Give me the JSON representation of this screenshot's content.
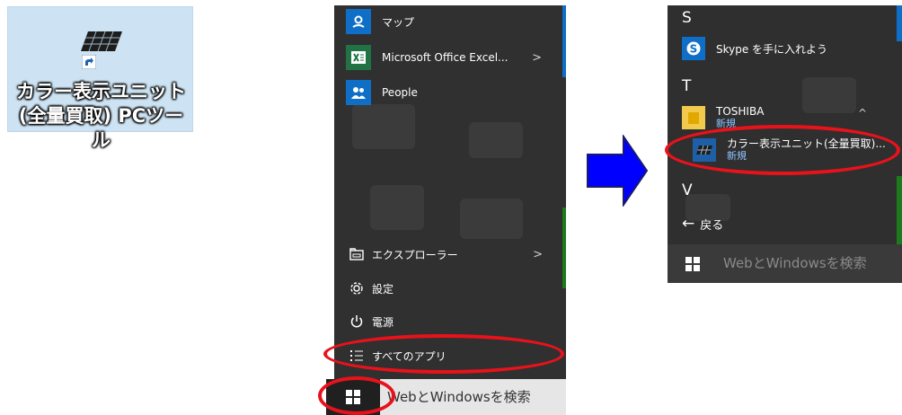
{
  "desktop_shortcut": {
    "label": "カラー表示ユニット(全量買取) PCツール",
    "icon": "solar-panel-icon"
  },
  "start_menu_left": {
    "apps": [
      {
        "label": "マップ",
        "icon": "maps-icon",
        "color": "#0f6fc6",
        "has_submenu": false
      },
      {
        "label": "Microsoft Office Excel...",
        "icon": "excel-icon",
        "color": "#217346",
        "has_submenu": true,
        "chevron": ">"
      },
      {
        "label": "People",
        "icon": "people-icon",
        "color": "#0f6fc6",
        "has_submenu": false
      }
    ],
    "system_items": [
      {
        "label": "エクスプローラー",
        "icon": "file-explorer-icon",
        "chevron": ">"
      },
      {
        "label": "設定",
        "icon": "gear-icon"
      },
      {
        "label": "電源",
        "icon": "power-icon"
      },
      {
        "label": "すべてのアプリ",
        "icon": "all-apps-list-icon"
      }
    ],
    "search_placeholder": "WebとWindowsを検索"
  },
  "start_menu_right": {
    "sections": [
      {
        "letter": "S",
        "apps": [
          {
            "label": "Skype を手に入れよう",
            "icon": "skype-icon",
            "color": "#0f6fc6"
          }
        ]
      },
      {
        "letter": "T",
        "apps": [
          {
            "label": "TOSHIBA",
            "sub": "新規",
            "icon": "folder-icon",
            "color": "#f2c94c",
            "chevron": "^"
          },
          {
            "label": "カラー表示ユニット(全量買取)...",
            "sub": "新規",
            "icon": "solar-panel-icon",
            "color": "#1e5fa8"
          }
        ]
      },
      {
        "letter": "V",
        "apps": []
      }
    ],
    "back_label": "戻る",
    "search_placeholder": "WebとWindowsを検索"
  },
  "colors": {
    "highlight_ring": "#e8121b",
    "arrow_fill": "#0000ff",
    "menu_bg": "#303030",
    "accent_blue": "#0f6fc6"
  }
}
